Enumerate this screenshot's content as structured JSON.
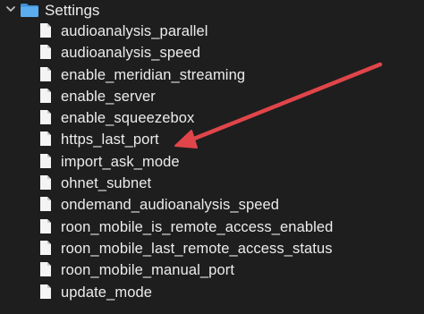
{
  "folder": {
    "label": "Settings",
    "icon": "folder-icon",
    "expanded": true,
    "disclosure_icon": "chevron-down-icon"
  },
  "files": [
    {
      "name": "audioanalysis_parallel"
    },
    {
      "name": "audioanalysis_speed"
    },
    {
      "name": "enable_meridian_streaming"
    },
    {
      "name": "enable_server"
    },
    {
      "name": "enable_squeezebox"
    },
    {
      "name": "https_last_port"
    },
    {
      "name": "import_ask_mode"
    },
    {
      "name": "ohnet_subnet"
    },
    {
      "name": "ondemand_audioanalysis_speed"
    },
    {
      "name": "roon_mobile_is_remote_access_enabled"
    },
    {
      "name": "roon_mobile_last_remote_access_status"
    },
    {
      "name": "roon_mobile_manual_port"
    },
    {
      "name": "update_mode"
    }
  ],
  "file_icon": "document-icon",
  "annotation": {
    "type": "arrow",
    "points_to": "https_last_port",
    "color": "#e0454a"
  },
  "colors": {
    "background": "#1e1e1e",
    "text": "#ececec",
    "folder_blue": "#4a9fe0",
    "file_white": "#f4f4f4",
    "arrow_red": "#e0454a"
  }
}
